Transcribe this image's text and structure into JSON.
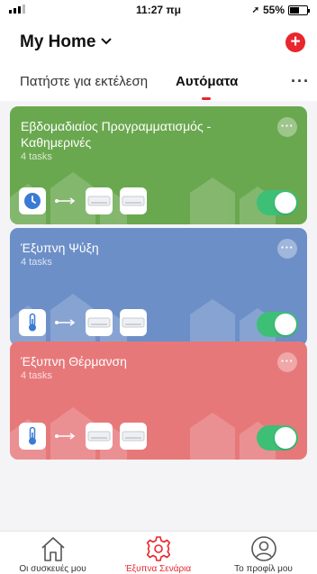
{
  "status_bar": {
    "time": "11:27 πμ",
    "battery": "55%"
  },
  "header": {
    "home_title": "My Home",
    "tabs": [
      {
        "label": "Πατήστε για εκτέλεση"
      },
      {
        "label": "Αυτόματα"
      }
    ]
  },
  "scenes": [
    {
      "title": "Εβδομαδιαίος Προγραμματισμός - Καθημερινές",
      "subtitle": "4 tasks",
      "color": "#6aa84f",
      "trigger_icon": "clock-icon",
      "enabled": true
    },
    {
      "title": "Έξυπνη Ψύξη",
      "subtitle": "4 tasks",
      "color": "#6d8fc8",
      "trigger_icon": "thermometer-icon",
      "enabled": true
    },
    {
      "title": "Έξυπνη Θέρμανση",
      "subtitle": "4 tasks",
      "color": "#e7787a",
      "trigger_icon": "thermometer-icon",
      "enabled": true
    }
  ],
  "tab_bar": {
    "items": [
      {
        "label": "Οι συσκευές μου",
        "icon": "home-icon"
      },
      {
        "label": "Έξυπνα Σενάρια",
        "icon": "gear-icon"
      },
      {
        "label": "Το προφίλ μου",
        "icon": "profile-icon"
      }
    ]
  },
  "colors": {
    "accent": "#e8262d",
    "toggle_on": "#3dbf76"
  }
}
